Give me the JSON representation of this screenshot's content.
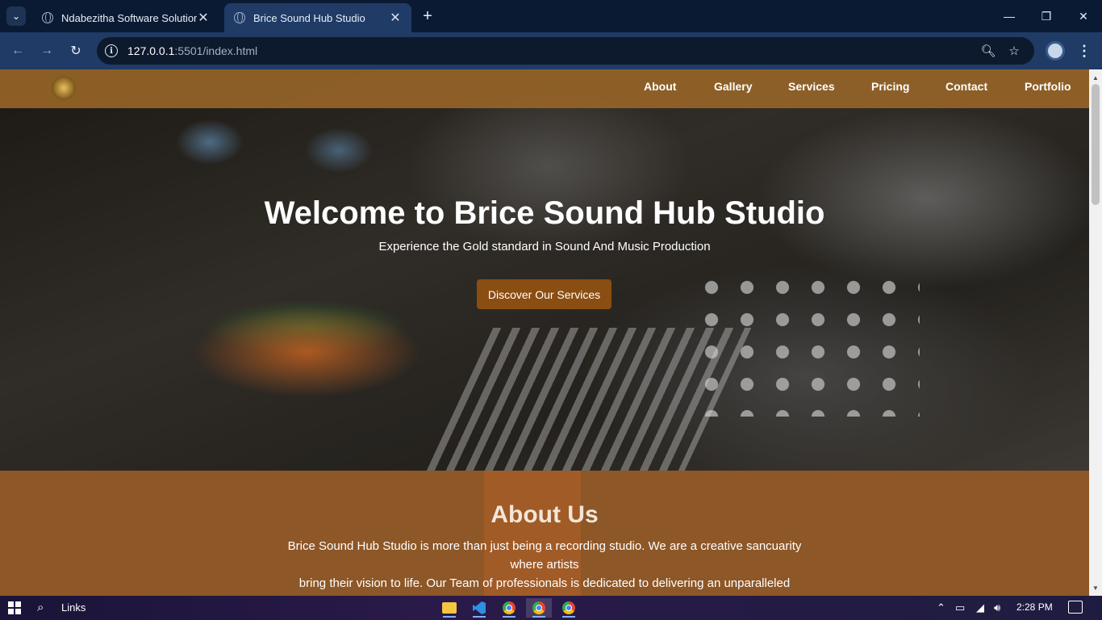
{
  "browser": {
    "tabs": [
      {
        "title": "Ndabezitha Software Solutions",
        "active": false
      },
      {
        "title": "Brice Sound Hub Studio",
        "active": true
      }
    ],
    "url_host": "127.0.0.1",
    "url_path": ":5501/index.html"
  },
  "site": {
    "nav": [
      "About",
      "Gallery",
      "Services",
      "Pricing",
      "Contact",
      "Portfolio"
    ],
    "hero": {
      "title": "Welcome to Brice Sound Hub Studio",
      "subtitle": "Experience the Gold standard in Sound And Music Production",
      "button": "Discover Our Services"
    },
    "about": {
      "title": "About Us",
      "lines": [
        "Brice Sound Hub Studio is more than just being a recording studio. We are a creative sancuarity where artists",
        "bring their vision to life. Our Team of professionals is dedicated to delivering an unparalleled"
      ]
    }
  },
  "taskbar": {
    "search_label": "Links",
    "time": "2:28 PM"
  },
  "icons": {
    "tab_list": "chevron-down-icon",
    "zoom": "magnifier-icon",
    "bookmark": "star-icon",
    "start": "windows-icon"
  }
}
